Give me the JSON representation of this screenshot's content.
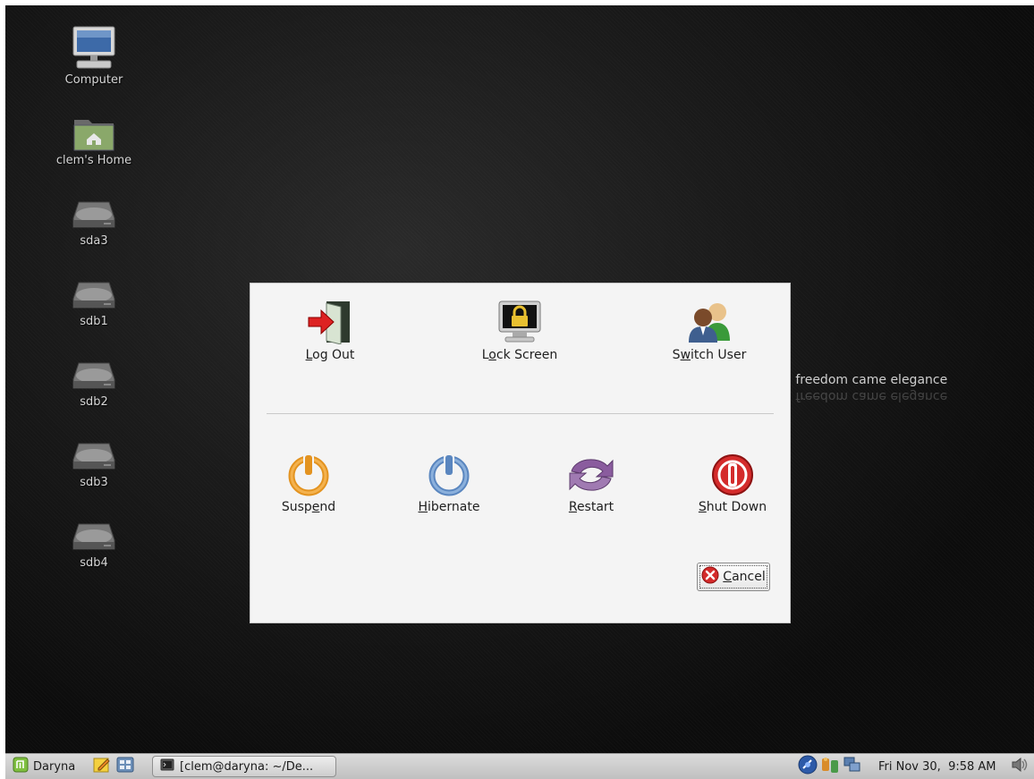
{
  "desktop": {
    "icons": [
      {
        "label": "Computer",
        "icon": "computer-icon"
      },
      {
        "label": "clem's Home",
        "icon": "home-folder-icon"
      },
      {
        "label": "sda3",
        "icon": "drive-icon"
      },
      {
        "label": "sdb1",
        "icon": "drive-icon"
      },
      {
        "label": "sdb2",
        "icon": "drive-icon"
      },
      {
        "label": "sdb3",
        "icon": "drive-icon"
      },
      {
        "label": "sdb4",
        "icon": "drive-icon"
      }
    ],
    "slogan": "n freedom came elegance"
  },
  "dialog": {
    "top_actions": [
      {
        "pre": "",
        "key": "L",
        "post": "og Out",
        "icon": "logout-icon"
      },
      {
        "pre": "L",
        "key": "o",
        "post": "ck Screen",
        "icon": "lock-screen-icon"
      },
      {
        "pre": "S",
        "key": "w",
        "post": "itch User",
        "icon": "switch-user-icon"
      }
    ],
    "bottom_actions": [
      {
        "pre": "Susp",
        "key": "e",
        "post": "nd",
        "icon": "suspend-icon",
        "color": "#f0a030"
      },
      {
        "pre": "",
        "key": "H",
        "post": "ibernate",
        "icon": "hibernate-icon",
        "color": "#6f9bd1"
      },
      {
        "pre": "",
        "key": "R",
        "post": "estart",
        "icon": "restart-icon",
        "color": "#8a5c9e"
      },
      {
        "pre": "",
        "key": "S",
        "post": "hut Down",
        "icon": "shutdown-icon",
        "color": "#d42b2b"
      }
    ],
    "cancel": {
      "pre": "",
      "key": "C",
      "post": "ancel",
      "icon": "cancel-icon"
    }
  },
  "taskbar": {
    "menu_label": "Daryna",
    "window_title": "[clem@daryna: ~/De...",
    "clock": "Fri Nov 30,  9:58 AM"
  }
}
